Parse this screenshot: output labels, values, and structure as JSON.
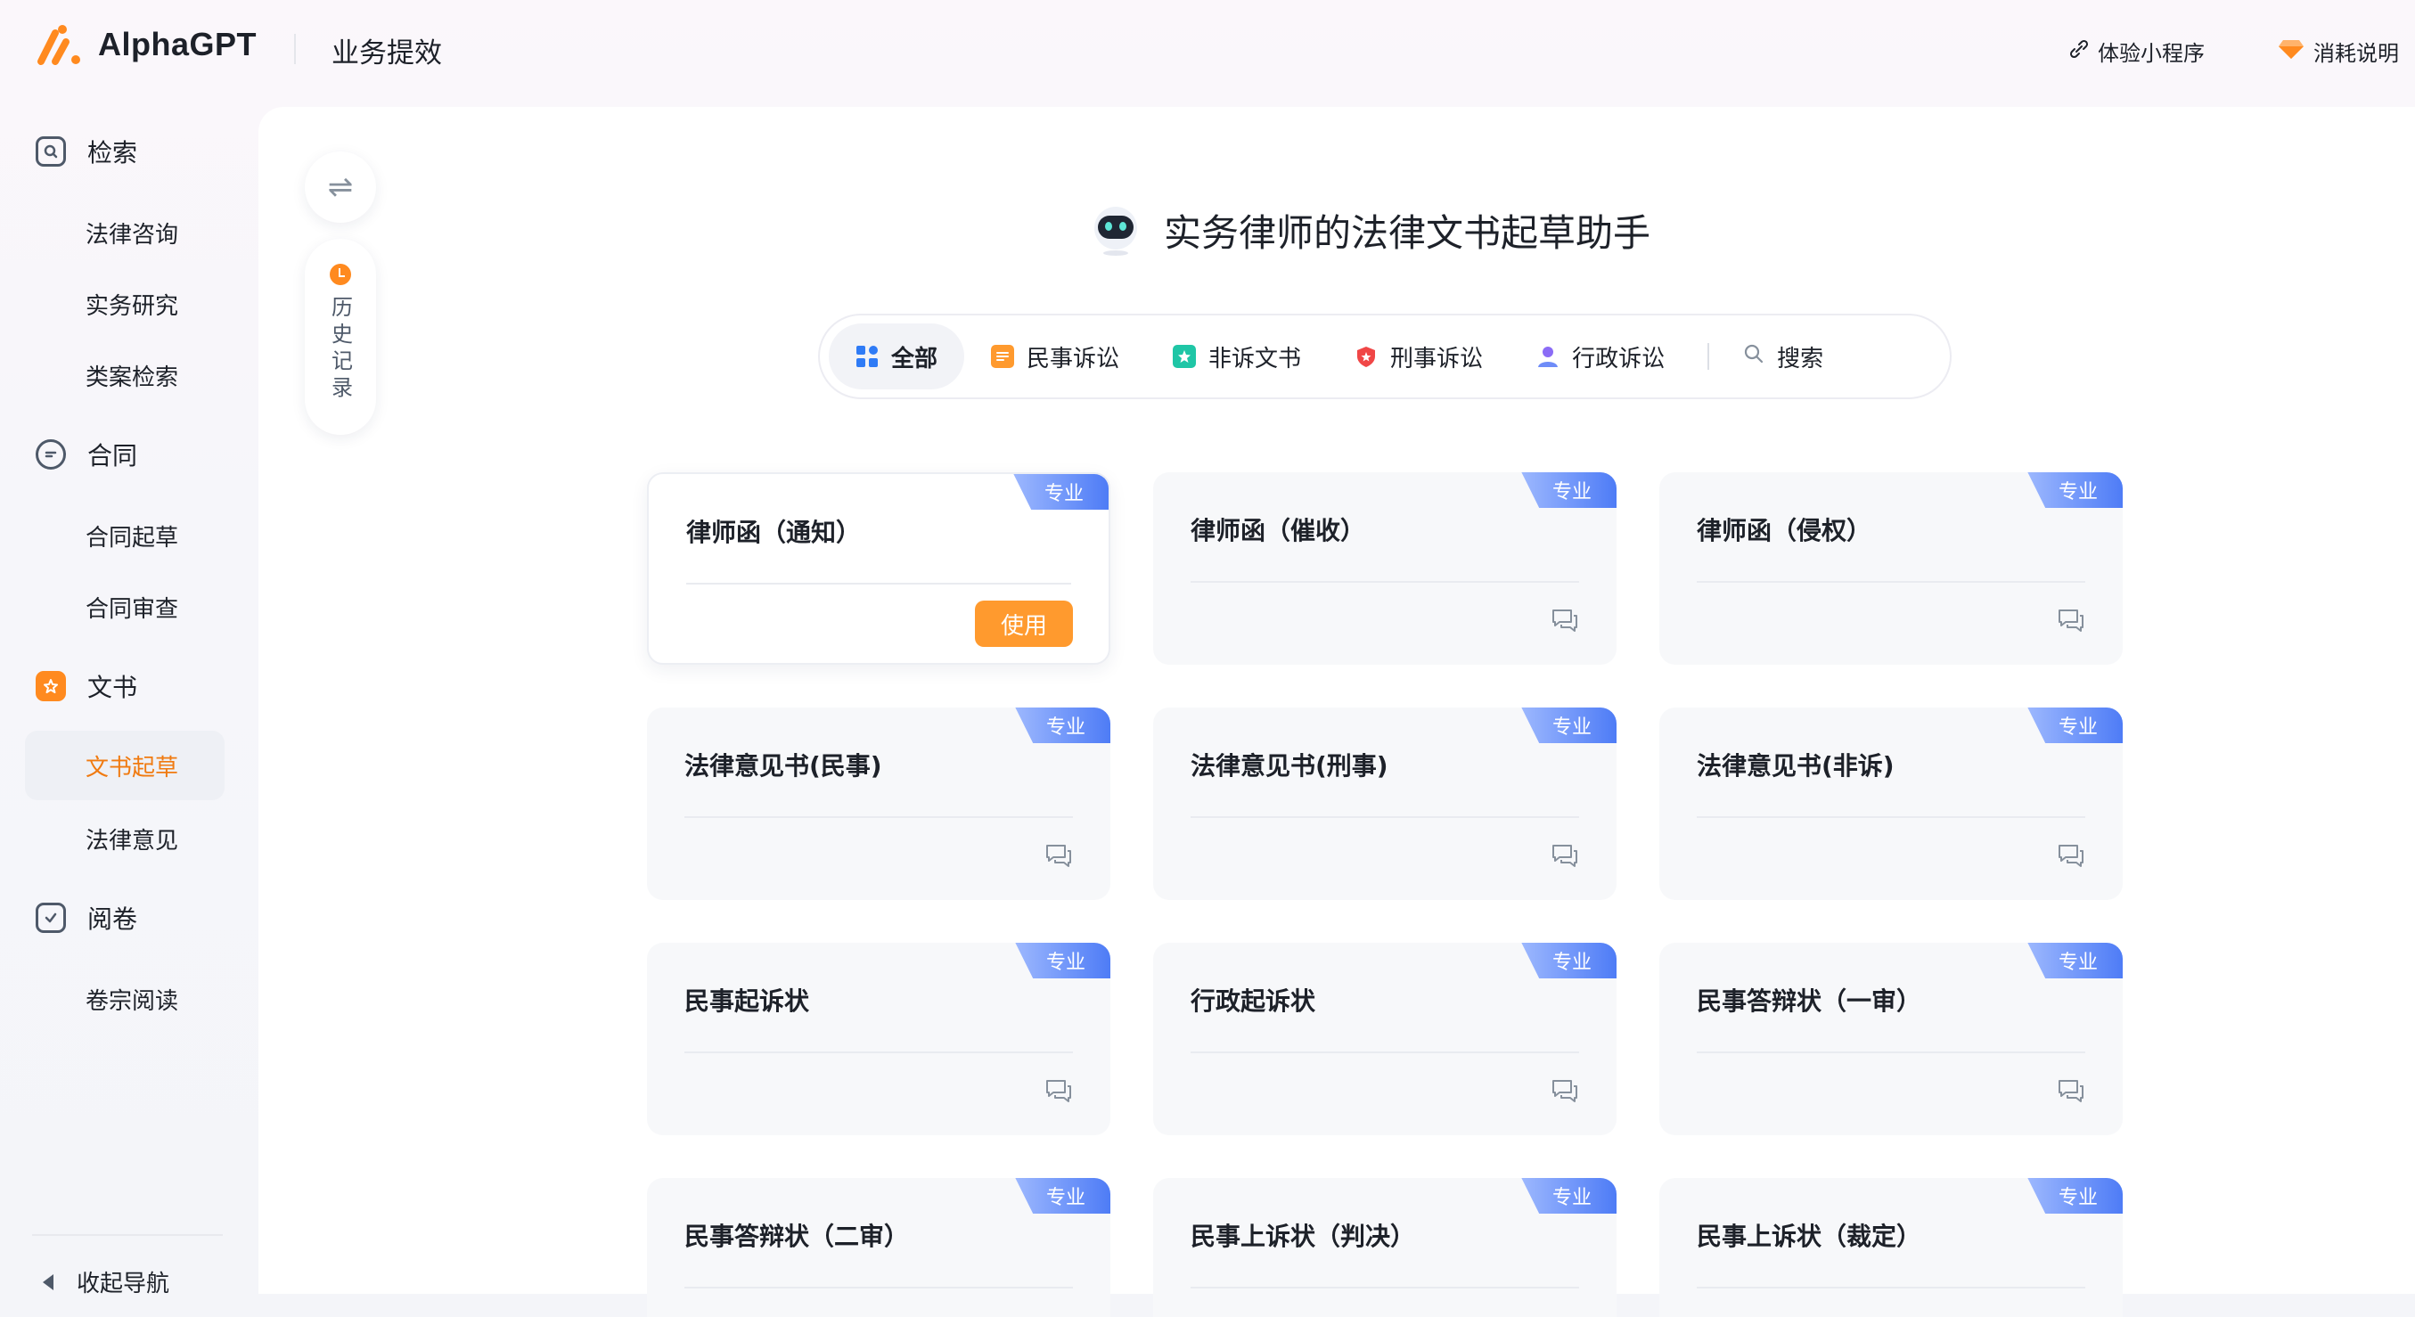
{
  "brand": {
    "name": "AlphaGPT",
    "section": "业务提效"
  },
  "header_links": {
    "mini_program": "体验小程序",
    "consumption": "消耗说明"
  },
  "sidebar": {
    "groups": [
      {
        "label": "检索",
        "items": [
          "法律咨询",
          "实务研究",
          "类案检索"
        ]
      },
      {
        "label": "合同",
        "items": [
          "合同起草",
          "合同审查"
        ]
      },
      {
        "label": "文书",
        "items": [
          "文书起草",
          "法律意见"
        ]
      },
      {
        "label": "阅卷",
        "items": [
          "卷宗阅读"
        ]
      }
    ],
    "active_item": "文书起草",
    "collapse_label": "收起导航"
  },
  "side_tools": {
    "history_label": "历史记录"
  },
  "hero": {
    "title": "实务律师的法律文书起草助手"
  },
  "filters": {
    "tabs": [
      "全部",
      "民事诉讼",
      "非诉文书",
      "刑事诉讼",
      "行政诉讼"
    ],
    "active": "全部",
    "search_label": "搜索"
  },
  "cards": [
    {
      "title": "律师函（通知）",
      "badge": "专业",
      "action": "使用"
    },
    {
      "title": "律师函（催收）",
      "badge": "专业"
    },
    {
      "title": "律师函（侵权）",
      "badge": "专业"
    },
    {
      "title": "法律意见书(民事)",
      "badge": "专业"
    },
    {
      "title": "法律意见书(刑事)",
      "badge": "专业"
    },
    {
      "title": "法律意见书(非诉)",
      "badge": "专业"
    },
    {
      "title": "民事起诉状",
      "badge": "专业"
    },
    {
      "title": "行政起诉状",
      "badge": "专业"
    },
    {
      "title": "民事答辩状（一审）",
      "badge": "专业"
    },
    {
      "title": "民事答辩状（二审）",
      "badge": "专业"
    },
    {
      "title": "民事上诉状（判决）",
      "badge": "专业"
    },
    {
      "title": "民事上诉状（裁定）",
      "badge": "专业"
    }
  ],
  "colors": {
    "accent": "#ff8a1f",
    "badge_blue": "#4e7cf6",
    "active_text": "#f07a10"
  }
}
